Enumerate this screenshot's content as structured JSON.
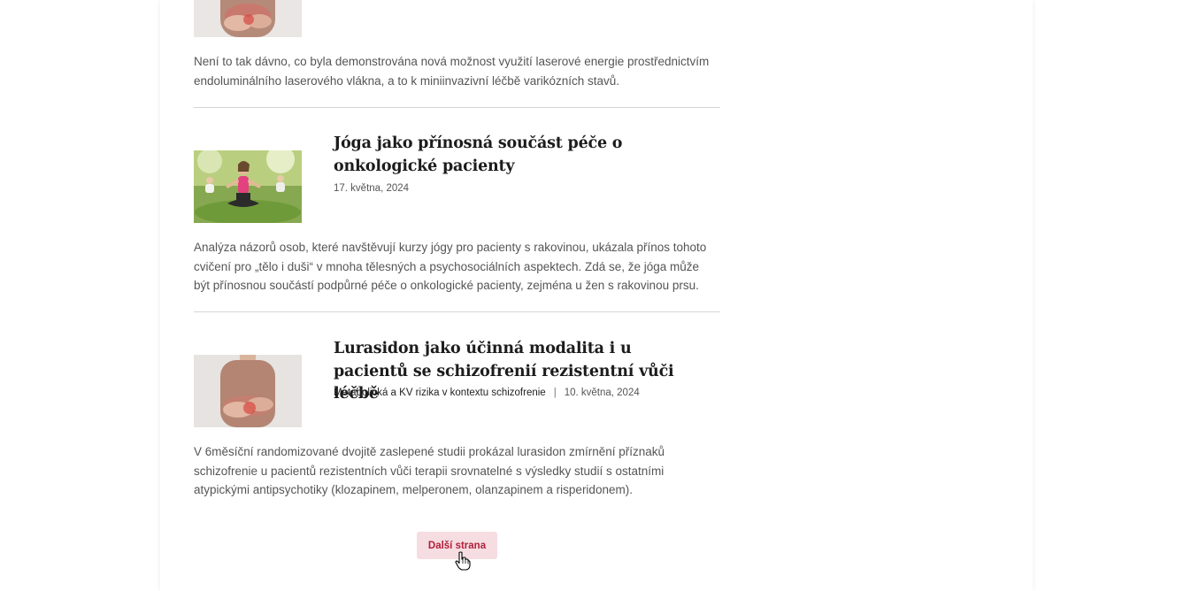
{
  "articles": [
    {
      "image": "woman-holding-abdomen-image",
      "excerpt": "Není to tak dávno, co byla demonstrována nová možnost využití laserové energie prostřednictvím endoluminálního laserového vlákna, a to k miniinvazivní léčbě varikózních stavů."
    },
    {
      "image": "yoga-group-meditation-image",
      "title": "Jóga jako přínosná součást péče o onkologické pacienty",
      "date": "17. května, 2024",
      "excerpt": "Analýza názorů osob, které navštěvují kurzy jógy pro pacienty s rakovinou, ukázala přínos tohoto cvičení pro „tělo i duši“ v mnoha tělesných a psychosociálních aspektech. Zdá se, že jóga může být přínosnou součástí podpůrné péče o onkologické pacienty, zejména u žen s rakovinou prsu."
    },
    {
      "image": "woman-holding-abdomen-image",
      "title": "Lurasidon jako účinná modalita i u pacientů se schizofrenií rezistentní vůči léčbě",
      "category": "Metabolická a KV rizika v kontextu schizofrenie",
      "separator": "|",
      "date": "10. května, 2024",
      "excerpt": "V 6měsíční randomizované dvojitě zaslepené studii prokázal lurasidon zmírnění příznaků schizofrenie u pacientů rezistentních vůči terapii srovnatelné s výsledky studií s ostatními atypickými antipsychotiky (klozapinem, melperonem, olanzapinem a risperidonem)."
    }
  ],
  "pagination": {
    "next_label": "Další strana"
  },
  "colors": {
    "accent": "#b0203a",
    "button_bg": "#f5dde1"
  },
  "cursor": "hand-pointer-cursor"
}
